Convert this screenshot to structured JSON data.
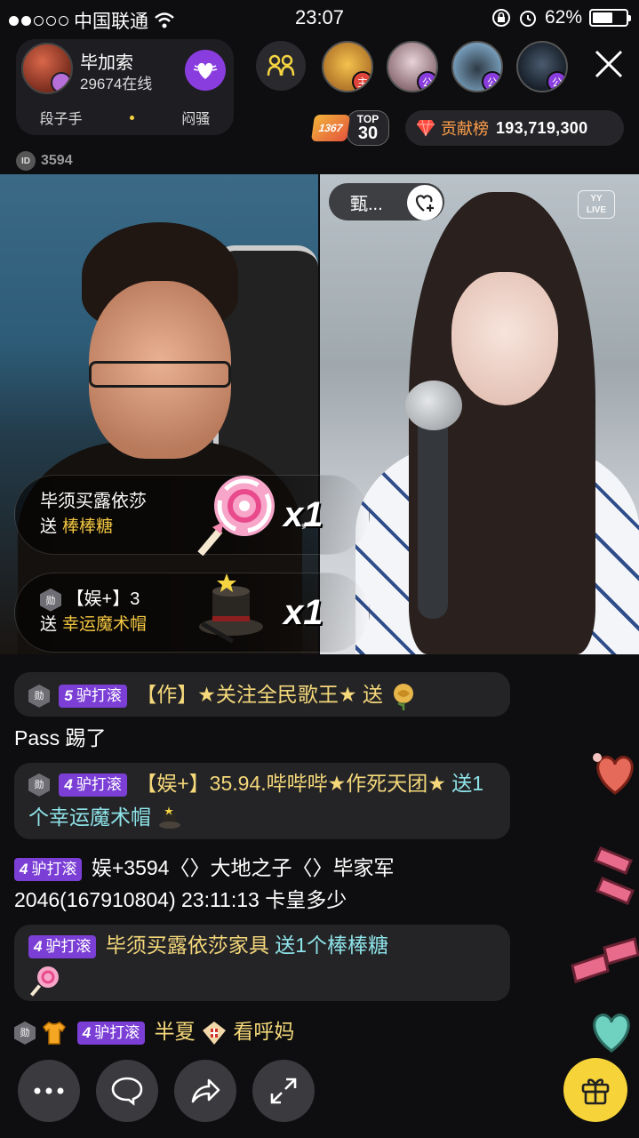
{
  "status_bar": {
    "carrier": "中国联通",
    "time": "23:07",
    "battery_percent": "62%",
    "battery_level": 0.62
  },
  "host": {
    "name": "毕加索",
    "online": "29674在线",
    "tags": [
      "段子手",
      "闷骚"
    ]
  },
  "viewers": [
    {
      "badge": "主",
      "badge_color": "#e0453b"
    },
    {
      "badge": "公",
      "badge_color": "#8a3dde"
    },
    {
      "badge": "公",
      "badge_color": "#8a3dde"
    },
    {
      "badge": "公",
      "badge_color": "#8a3dde"
    }
  ],
  "top_rank": {
    "line1": "TOP",
    "line2": "30",
    "logo": "1367"
  },
  "contribution": {
    "label": "贡献榜",
    "value": "193,719,300"
  },
  "room_id": {
    "badge": "ID",
    "value": "3594"
  },
  "guest": {
    "name": "甄...",
    "watermark_line1": "YY",
    "watermark_line2": "LIVE"
  },
  "gifts": [
    {
      "user": "毕须买露依莎",
      "send": "送",
      "item": "棒棒糖",
      "count": "x1",
      "rank_badge": ""
    },
    {
      "user": "【娱+】3",
      "send": "送",
      "item": "幸运魔术帽",
      "count": "x1",
      "rank_badge": "勋"
    }
  ],
  "chat": [
    {
      "rank_badge": "勋",
      "level": "5",
      "level_label": "驴打滚",
      "text": "【作】★关注全民歌王★ 送"
    },
    {
      "plain": "Pass 踢了"
    },
    {
      "rank_badge": "勋",
      "level": "4",
      "level_label": "驴打滚",
      "text": "【娱+】35.94.哔哔哔★作死天团★",
      "gift_text": "送1个幸运魔术帽"
    },
    {
      "level": "4",
      "level_label": "驴打滚",
      "text": "娱+3594〈〉大地之子〈〉毕家军2046(167910804) 23:11:13 卡皇多少"
    },
    {
      "level": "4",
      "level_label": "驴打滚",
      "text": "毕须买露依莎家具",
      "gift_text": "送1个棒棒糖"
    },
    {
      "rank_badge": "勋",
      "level": "4",
      "level_label": "驴打滚",
      "text": "半夏",
      "text2": "看呼妈"
    }
  ],
  "bottom_bar": {
    "more_icon": "ellipsis-icon",
    "chat_icon": "speech-bubble-icon",
    "share_icon": "share-arrow-icon",
    "expand_icon": "expand-icon",
    "gift_icon": "gift-box-icon"
  },
  "colors": {
    "accent_purple": "#8a3dde",
    "gold": "#f5c842",
    "gift_button": "#f7d33a",
    "contribution_label": "#ff9f4a"
  }
}
